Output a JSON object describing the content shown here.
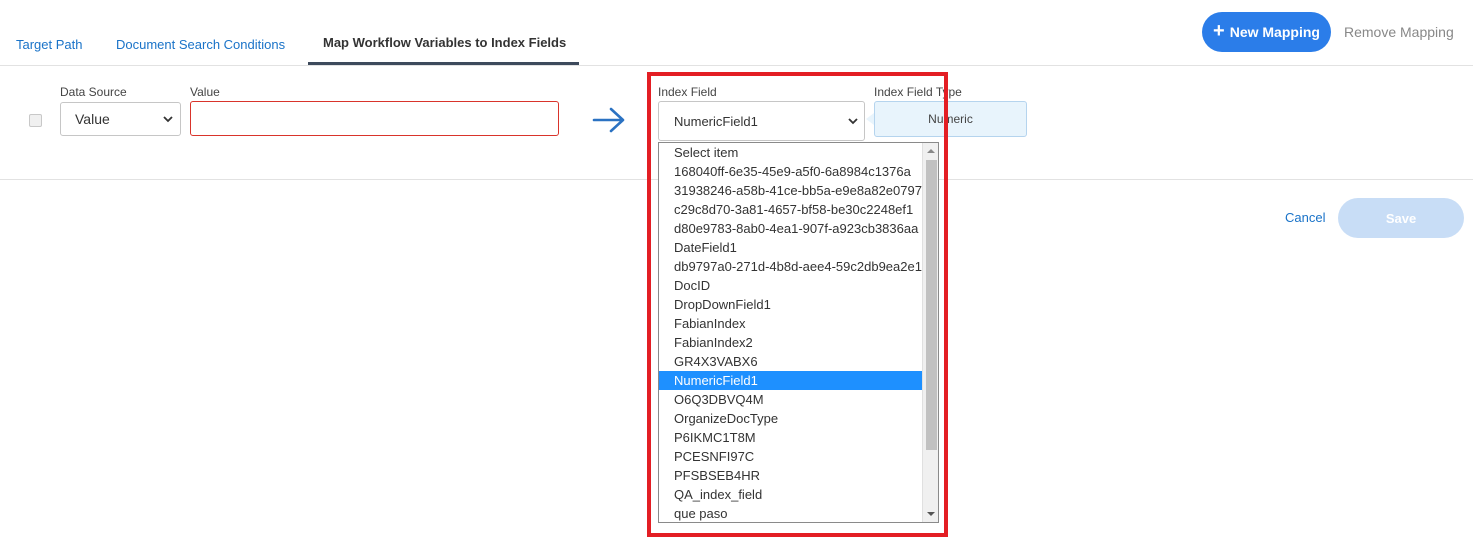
{
  "tabs": [
    {
      "label": "Target Path",
      "active": false
    },
    {
      "label": "Document Search Conditions",
      "active": false
    },
    {
      "label": "Map Workflow Variables to Index Fields",
      "active": true
    }
  ],
  "toolbar": {
    "new_mapping_label": "New Mapping",
    "remove_mapping_label": "Remove Mapping"
  },
  "mapping": {
    "data_source_label": "Data Source",
    "data_source_value": "Value",
    "value_label": "Value",
    "value_value": "",
    "index_field_label": "Index Field",
    "index_field_value": "NumericField1",
    "index_field_type_label": "Index Field Type",
    "index_field_type_value": "Numeric"
  },
  "dropdown": {
    "items": [
      "Select item",
      "168040ff-6e35-45e9-a5f0-6a8984c1376a",
      "31938246-a58b-41ce-bb5a-e9e8a82e0797",
      "c29c8d70-3a81-4657-bf58-be30c2248ef1",
      "d80e9783-8ab0-4ea1-907f-a923cb3836aa",
      "DateField1",
      "db9797a0-271d-4b8d-aee4-59c2db9ea2e1",
      "DocID",
      "DropDownField1",
      "FabianIndex",
      "FabianIndex2",
      "GR4X3VABX6",
      "NumericField1",
      "O6Q3DBVQ4M",
      "OrganizeDocType",
      "P6IKMC1T8M",
      "PCESNFI97C",
      "PFSBSEB4HR",
      "QA_index_field",
      "que paso"
    ],
    "selected_index": 12
  },
  "actions": {
    "cancel_label": "Cancel",
    "save_label": "Save"
  },
  "colors": {
    "accent": "#2b7de9",
    "link": "#1a73c8",
    "error_border": "#d9342b",
    "highlight": "#e31e24",
    "selected_item": "#1e90ff"
  }
}
